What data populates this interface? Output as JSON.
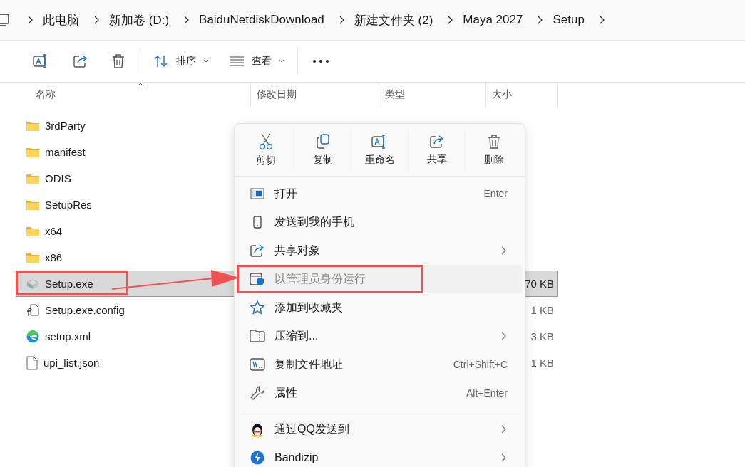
{
  "breadcrumb": [
    "此电脑",
    "新加卷 (D:)",
    "BaiduNetdiskDownload",
    "新建文件夹 (2)",
    "Maya 2027",
    "Setup"
  ],
  "toolbar": {
    "sort": "排序",
    "view": "查看"
  },
  "columns": [
    "名称",
    "修改日期",
    "类型",
    "大小"
  ],
  "files": [
    {
      "name": "3rdParty",
      "kind": "folder",
      "selected": false,
      "annotated": false
    },
    {
      "name": "manifest",
      "kind": "folder",
      "selected": false,
      "annotated": false
    },
    {
      "name": "ODIS",
      "kind": "folder",
      "selected": false,
      "annotated": false
    },
    {
      "name": "SetupRes",
      "kind": "folder",
      "selected": false,
      "annotated": false
    },
    {
      "name": "x64",
      "kind": "folder",
      "selected": false,
      "annotated": false
    },
    {
      "name": "x86",
      "kind": "folder",
      "selected": false,
      "annotated": false
    },
    {
      "name": "Setup.exe",
      "kind": "exe",
      "size": "70 KB",
      "selected": true,
      "annotated": true
    },
    {
      "name": "Setup.exe.config",
      "kind": "config",
      "size": "1 KB",
      "selected": false,
      "annotated": false
    },
    {
      "name": "setup.xml",
      "kind": "edge",
      "size": "3 KB",
      "selected": false,
      "annotated": false
    },
    {
      "name": "upi_list.json",
      "kind": "file",
      "size": "1 KB",
      "selected": false,
      "annotated": false
    }
  ],
  "context_menu": {
    "actions": [
      {
        "label": "剪切",
        "kind": "cut"
      },
      {
        "label": "复制",
        "kind": "copy"
      },
      {
        "label": "重命名",
        "kind": "rename"
      },
      {
        "label": "共享",
        "kind": "share"
      },
      {
        "label": "删除",
        "kind": "delete"
      }
    ],
    "items": [
      {
        "label": "打开",
        "kind": "open",
        "shortcut": "Enter",
        "submenu": false,
        "disabled": false,
        "annotated": false
      },
      {
        "label": "发送到我的手机",
        "kind": "phone",
        "submenu": false,
        "disabled": false,
        "annotated": false
      },
      {
        "label": "共享对象",
        "kind": "share",
        "submenu": true,
        "disabled": false,
        "annotated": false
      },
      {
        "label": "以管理员身份运行",
        "kind": "shield",
        "submenu": false,
        "disabled": true,
        "annotated": true
      },
      {
        "label": "添加到收藏夹",
        "kind": "star",
        "submenu": false,
        "disabled": false,
        "annotated": false
      },
      {
        "label": "压缩到...",
        "kind": "zip",
        "submenu": true,
        "disabled": false,
        "annotated": false
      },
      {
        "label": "复制文件地址",
        "kind": "path",
        "shortcut": "Ctrl+Shift+C",
        "submenu": false,
        "disabled": false,
        "annotated": false
      },
      {
        "label": "属性",
        "kind": "wrench",
        "shortcut": "Alt+Enter",
        "submenu": false,
        "disabled": false,
        "annotated": false
      },
      {
        "kind": "separator"
      },
      {
        "label": "通过QQ发送到",
        "kind": "qq",
        "submenu": true,
        "disabled": false,
        "annotated": false
      },
      {
        "label": "Bandizip",
        "kind": "bandizip",
        "submenu": true,
        "disabled": false,
        "annotated": false
      }
    ]
  }
}
